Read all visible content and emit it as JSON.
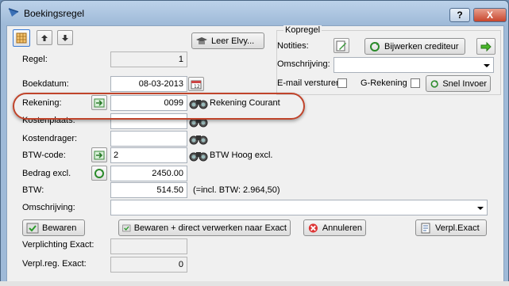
{
  "window": {
    "title": "Boekingsregel",
    "help": "?",
    "close": "X"
  },
  "toolbar": {
    "up": "up-arrow-icon",
    "down": "down-arrow-icon"
  },
  "fields": {
    "regel": {
      "label": "Regel:",
      "value": "1"
    },
    "boekdatum": {
      "label": "Boekdatum:",
      "value": "08-03-2013"
    },
    "rekening": {
      "label": "Rekening:",
      "value": "0099",
      "desc": "Rekening Courant"
    },
    "kostenplaats": {
      "label": "Kostenplaats:",
      "value": ""
    },
    "kostendrager": {
      "label": "Kostendrager:",
      "value": ""
    },
    "btwcode": {
      "label": "BTW-code:",
      "value": "2",
      "desc": "BTW Hoog excl."
    },
    "bedrag": {
      "label": "Bedrag excl.",
      "value": "2450.00"
    },
    "btw": {
      "label": "BTW:",
      "value": "514.50",
      "note": "(=incl. BTW: 2.964,50)"
    },
    "omschrijving": {
      "label": "Omschrijving:",
      "value": ""
    }
  },
  "leer_button": "Leer Elvy...",
  "kopregel": {
    "legend": "Kopregel",
    "notities_label": "Notities:",
    "bijwerken_button": "Bijwerken crediteur",
    "omschrijving_label": "Omschrijving:",
    "email_label": "E-mail versturen",
    "grekening_label": "G-Rekening",
    "snel_invoer_button": "Snel Invoer"
  },
  "actions": {
    "bewaren": "Bewaren",
    "bewaren_direct": "Bewaren + direct verwerken naar Exact",
    "annuleren": "Annuleren",
    "verpl_exact": "Verpl.Exact"
  },
  "bottom": {
    "verplichting_label": "Verplichting Exact:",
    "verplichting_value": "",
    "verplreg_label": "Verpl.reg. Exact:",
    "verplreg_value": "0"
  },
  "colors": {
    "highlight": "#c0442b",
    "titlebar": "#bcd2ea"
  }
}
